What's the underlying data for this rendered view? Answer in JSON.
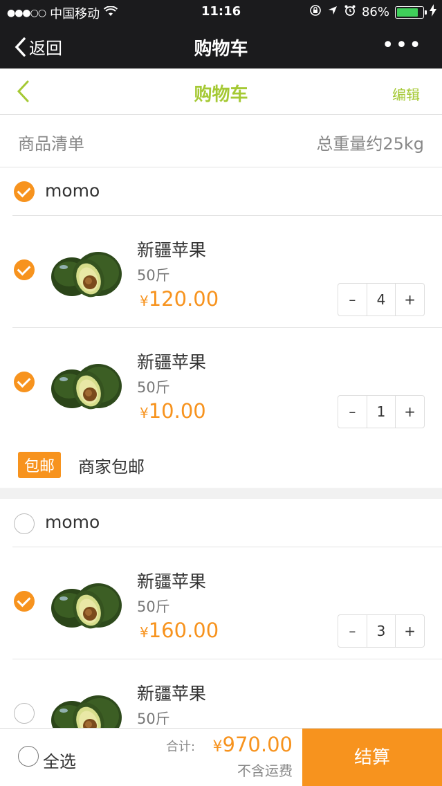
{
  "status_bar": {
    "carrier": "中国移动",
    "time": "11:16",
    "battery": "86%"
  },
  "wechat_nav": {
    "back_label": "返回",
    "title": "购物车",
    "more": "•••"
  },
  "page_header": {
    "title": "购物车",
    "edit_label": "编辑"
  },
  "list_header": {
    "left": "商品清单",
    "right": "总重量约25kg"
  },
  "shops": [
    {
      "name": "momo",
      "checked": true,
      "items": [
        {
          "name": "新疆苹果",
          "spec": "50斤",
          "currency": "¥",
          "price": "120.00",
          "qty": "4",
          "checked": true
        },
        {
          "name": "新疆苹果",
          "spec": "50斤",
          "currency": "¥",
          "price": "10.00",
          "qty": "1",
          "checked": true
        }
      ],
      "shipping": {
        "badge": "包邮",
        "text": "商家包邮"
      }
    },
    {
      "name": "momo",
      "checked": false,
      "items": [
        {
          "name": "新疆苹果",
          "spec": "50斤",
          "currency": "¥",
          "price": "160.00",
          "qty": "3",
          "checked": true
        },
        {
          "name": "新疆苹果",
          "spec": "50斤",
          "currency": "¥",
          "price": "",
          "qty": "",
          "checked": false
        }
      ]
    }
  ],
  "stepper": {
    "minus": "–",
    "plus": "+"
  },
  "footer": {
    "select_all": "全选",
    "total_label": "合计:",
    "currency": "¥",
    "total": "970.00",
    "shipping_note": "不含运费",
    "checkout": "结算"
  },
  "colors": {
    "accent": "#f7931e",
    "header_green": "#a5c934",
    "nav_bg": "#1b1b1d"
  }
}
